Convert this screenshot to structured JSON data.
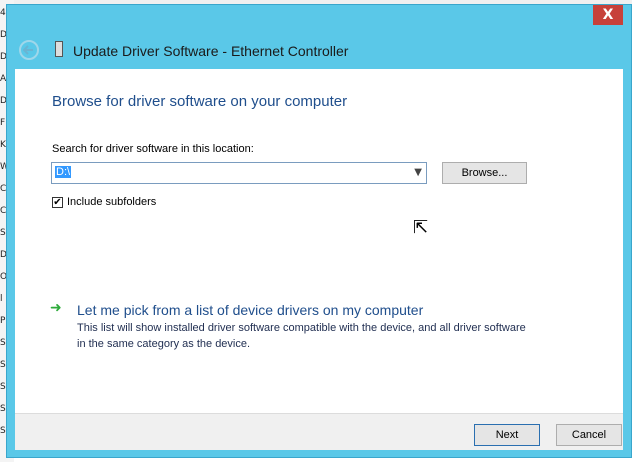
{
  "window": {
    "title": "Update Driver Software - Ethernet Controller",
    "close_label": "X"
  },
  "page": {
    "heading": "Browse for driver software on your computer",
    "search_label": "Search for driver software in this location:",
    "path_value": "D:\\",
    "browse_label": "Browse...",
    "include_subfolders_label": "Include subfolders",
    "include_subfolders_checked": "✔"
  },
  "pick_link": {
    "title": "Let me pick from a list of device drivers on my computer",
    "description": "This list will show installed driver software compatible with the device, and all driver software in the same category as the device."
  },
  "footer": {
    "next_label": "Next",
    "cancel_label": "Cancel"
  },
  "background_letters": [
    "4",
    "D",
    "D",
    "A",
    "D",
    "F",
    "K",
    "W",
    "C",
    "C",
    "S",
    "D",
    "O",
    "l",
    "P",
    "S",
    "S",
    "S",
    "S",
    "S"
  ]
}
